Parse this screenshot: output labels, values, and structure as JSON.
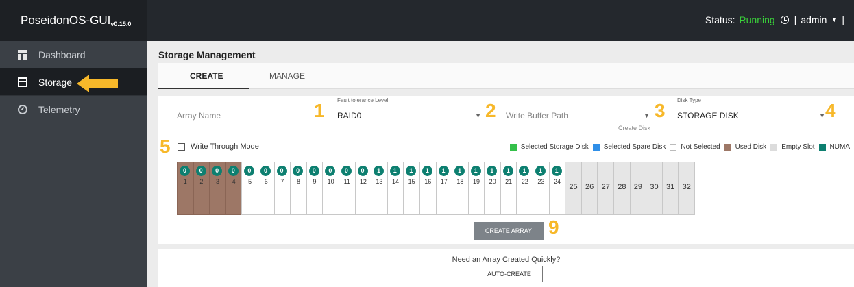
{
  "header": {
    "brand": "PoseidonOS-GUI",
    "version": "v0.15.0",
    "status_label": "Status:",
    "status_value": "Running",
    "user": "admin",
    "sep": "|"
  },
  "sidebar": {
    "items": [
      {
        "label": "Dashboard",
        "icon": "dashboard-icon"
      },
      {
        "label": "Storage",
        "icon": "storage-icon"
      },
      {
        "label": "Telemetry",
        "icon": "telemetry-icon"
      }
    ]
  },
  "main": {
    "title": "Storage Management",
    "tabs": [
      {
        "label": "CREATE"
      },
      {
        "label": "MANAGE"
      }
    ],
    "form": {
      "array_name_placeholder": "Array Name",
      "fault_label": "Fault tolerance Level",
      "fault_value": "RAID0",
      "write_buffer_placeholder": "Write Buffer Path",
      "create_disk": "Create Disk",
      "disk_type_label": "Disk Type",
      "disk_type_value": "STORAGE DISK",
      "write_through": "Write Through Mode"
    },
    "legend": [
      {
        "label": "Selected Storage Disk",
        "color": "#34c04a"
      },
      {
        "label": "Selected Spare Disk",
        "color": "#2f8fe8"
      },
      {
        "label": "Not Selected",
        "color": "#ffffff"
      },
      {
        "label": "Used Disk",
        "color": "#9d7766"
      },
      {
        "label": "Empty Slot",
        "color": "#dcdcdc"
      },
      {
        "label": "NUMA",
        "color": "#0d7f70"
      }
    ],
    "slots": [
      {
        "n": "1",
        "numa": "0",
        "state": "used"
      },
      {
        "n": "2",
        "numa": "0",
        "state": "used"
      },
      {
        "n": "3",
        "numa": "0",
        "state": "used"
      },
      {
        "n": "4",
        "numa": "0",
        "state": "used"
      },
      {
        "n": "5",
        "numa": "0",
        "state": "normal"
      },
      {
        "n": "6",
        "numa": "0",
        "state": "normal"
      },
      {
        "n": "7",
        "numa": "0",
        "state": "normal"
      },
      {
        "n": "8",
        "numa": "0",
        "state": "normal"
      },
      {
        "n": "9",
        "numa": "0",
        "state": "normal"
      },
      {
        "n": "10",
        "numa": "0",
        "state": "normal"
      },
      {
        "n": "11",
        "numa": "0",
        "state": "normal"
      },
      {
        "n": "12",
        "numa": "0",
        "state": "normal"
      },
      {
        "n": "13",
        "numa": "1",
        "state": "normal"
      },
      {
        "n": "14",
        "numa": "1",
        "state": "normal"
      },
      {
        "n": "15",
        "numa": "1",
        "state": "normal"
      },
      {
        "n": "16",
        "numa": "1",
        "state": "normal"
      },
      {
        "n": "17",
        "numa": "1",
        "state": "normal"
      },
      {
        "n": "18",
        "numa": "1",
        "state": "normal"
      },
      {
        "n": "19",
        "numa": "1",
        "state": "normal"
      },
      {
        "n": "20",
        "numa": "1",
        "state": "normal"
      },
      {
        "n": "21",
        "numa": "1",
        "state": "normal"
      },
      {
        "n": "22",
        "numa": "1",
        "state": "normal"
      },
      {
        "n": "23",
        "numa": "1",
        "state": "normal"
      },
      {
        "n": "24",
        "numa": "1",
        "state": "normal"
      },
      {
        "n": "25",
        "numa": "",
        "state": "empty"
      },
      {
        "n": "26",
        "numa": "",
        "state": "empty"
      },
      {
        "n": "27",
        "numa": "",
        "state": "empty"
      },
      {
        "n": "28",
        "numa": "",
        "state": "empty"
      },
      {
        "n": "29",
        "numa": "",
        "state": "empty"
      },
      {
        "n": "30",
        "numa": "",
        "state": "empty"
      },
      {
        "n": "31",
        "numa": "",
        "state": "empty"
      },
      {
        "n": "32",
        "numa": "",
        "state": "empty"
      }
    ],
    "create_button": "CREATE ARRAY",
    "quick_text": "Need an Array Created Quickly?",
    "auto_button": "AUTO-CREATE"
  },
  "annotations": {
    "n1": "1",
    "n2": "2",
    "n3": "3",
    "n4": "4",
    "n5": "5",
    "n9": "9"
  },
  "colors": {
    "accent": "#f7b82a",
    "running": "#3ad13a",
    "numa": "#0d7f70"
  }
}
